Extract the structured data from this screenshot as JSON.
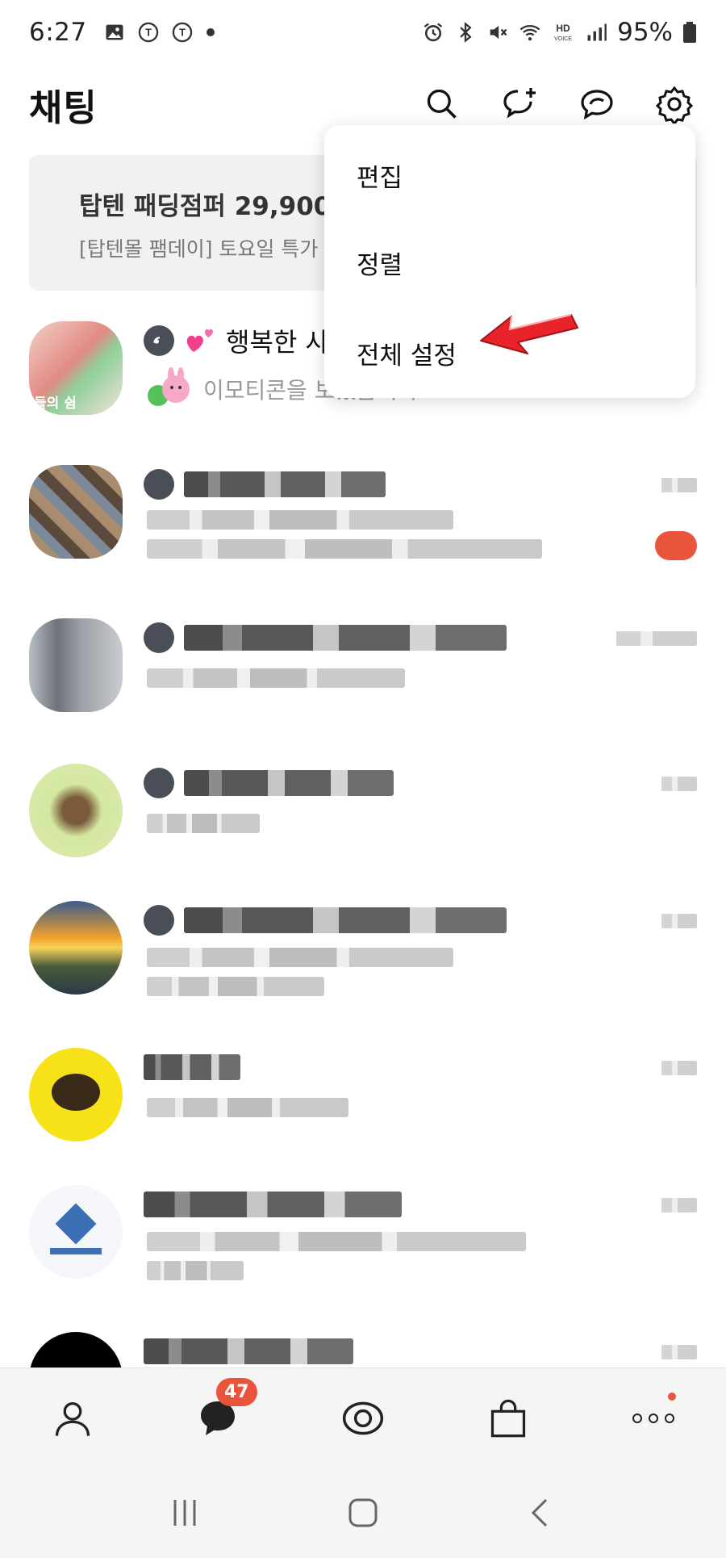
{
  "status_bar": {
    "time": "6:27",
    "battery": "95%",
    "left_icons": [
      "gallery-icon",
      "t-sync-icon",
      "t-sync-icon",
      "dot-icon"
    ],
    "right_icons": [
      "alarm-icon",
      "bluetooth-icon",
      "mute-icon",
      "wifi-icon",
      "hd-voice-icon",
      "signal-icon",
      "battery-icon"
    ]
  },
  "header": {
    "title": "채팅",
    "icons": [
      "search-icon",
      "new-chat-icon",
      "open-chat-icon",
      "settings-icon"
    ]
  },
  "ad": {
    "title": "탑텐 패딩점퍼 29,900",
    "subtitle": "[탑텐몰 팸데이] 토요일 특가"
  },
  "chats": [
    {
      "name": "행복한 사",
      "preview": "이모티콘을 보냈습니다.",
      "avatar_text": "들의 쉼"
    },
    {
      "name": "",
      "preview": ""
    },
    {
      "name": "",
      "preview": ""
    },
    {
      "name": "",
      "preview": ""
    },
    {
      "name": "",
      "preview": ""
    },
    {
      "name": "",
      "preview": ""
    },
    {
      "name": "",
      "preview": ""
    },
    {
      "name": "",
      "preview": ""
    }
  ],
  "menu": {
    "items": [
      "편집",
      "정렬",
      "전체 설정"
    ]
  },
  "bottom_nav": {
    "items": [
      "friends-icon",
      "chat-icon",
      "openchat-icon",
      "shopping-icon",
      "more-icon"
    ],
    "chat_badge": "47"
  },
  "colors": {
    "accent": "#e9553c",
    "annotation_arrow": "#e8232a",
    "banner_bg": "#f1f1f1"
  }
}
